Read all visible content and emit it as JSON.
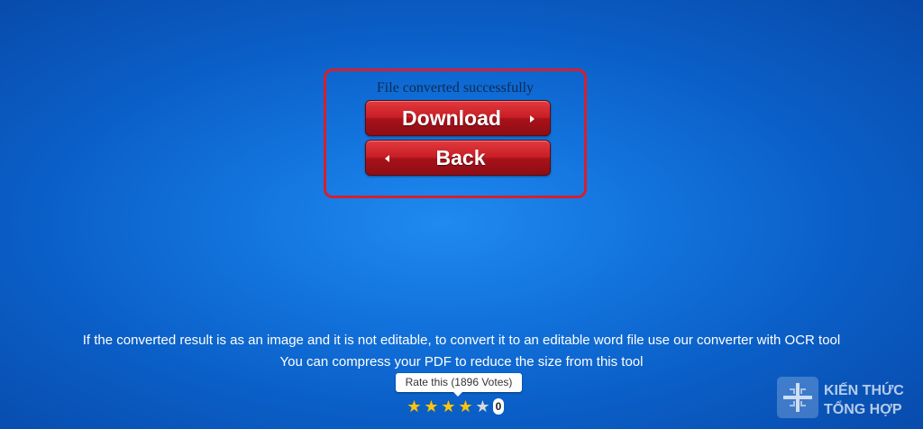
{
  "result": {
    "status": "File converted successfully",
    "download_label": "Download",
    "back_label": "Back"
  },
  "info": {
    "ocr_note": "If the converted result is as an image and it is not editable, to convert it to an editable word file use our converter with OCR tool",
    "compress_note": "You can compress your PDF to reduce the size from this tool"
  },
  "rating": {
    "tooltip": "Rate this (1896 Votes)",
    "stars_filled": 4,
    "stars_total": 5,
    "count": "0"
  },
  "watermark": {
    "line1": "KIẾN THỨC",
    "line2": "TỔNG HỢP"
  },
  "colors": {
    "background": "#0a5ec6",
    "highlight_border": "#d61f2e",
    "button_red": "#c81d25",
    "star_filled": "#f5c518",
    "star_empty": "#d9d9d9"
  }
}
